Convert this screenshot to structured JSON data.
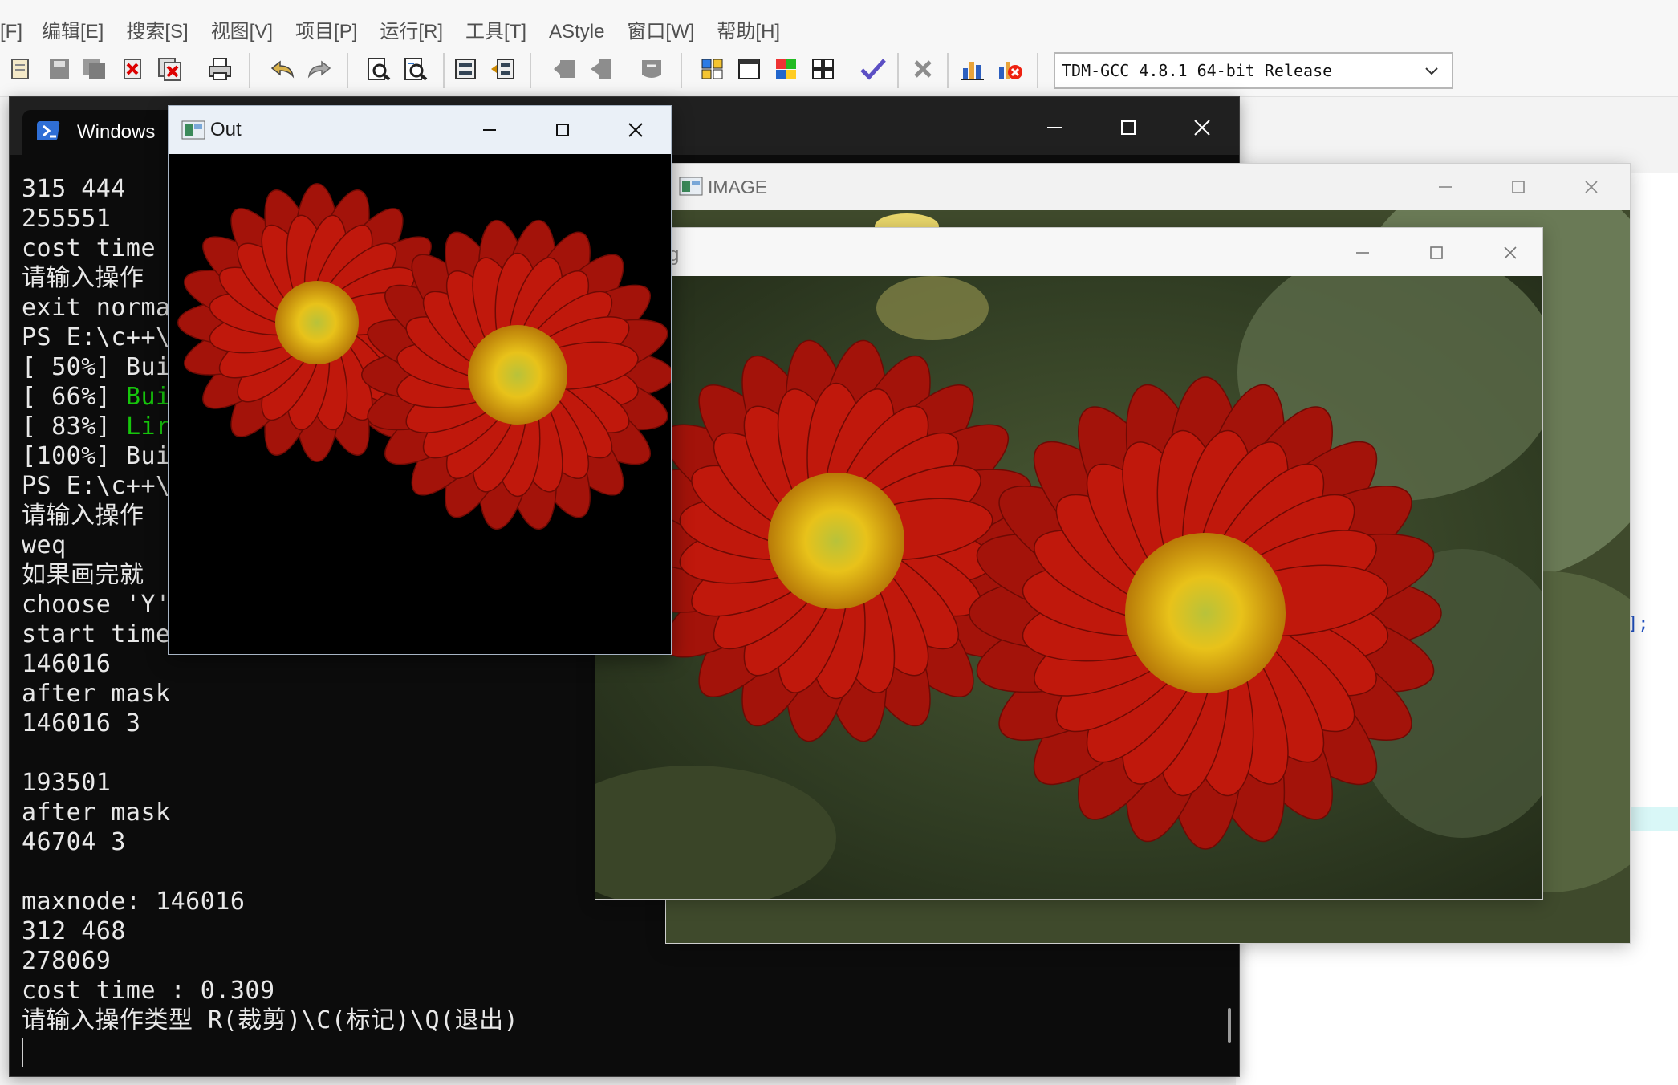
{
  "ide": {
    "menu": [
      "[F]",
      "编辑[E]",
      "搜索[S]",
      "视图[V]",
      "项目[P]",
      "运行[R]",
      "工具[T]",
      "AStyle",
      "窗口[W]",
      "帮助[H]"
    ],
    "compiler": "TDM-GCC 4.8.1 64-bit Release",
    "editor_fragment": "];"
  },
  "terminal": {
    "tab_label": "Windows",
    "lines": [
      "315 444",
      "255551",
      "cost time",
      "请输入操作",
      "exit norma",
      "PS E:\\c++\\",
      "[ 50%] Bui",
      "[ 66%] ",
      "[ 83%] ",
      "[100%] Bui",
      "PS E:\\c++\\",
      "请输入操作",
      "weq",
      "如果画完就",
      "choose 'Y'",
      "start time",
      "146016",
      "after mask",
      "146016 3",
      "",
      "193501",
      "after mask",
      "46704 3",
      "",
      "maxnode: 146016",
      "312 468",
      "278069",
      "cost time : 0.309",
      "请输入操作类型 R(裁剪)\\C(标记)\\Q(退出)"
    ],
    "green_66": "Bui",
    "green_83": "Lir"
  },
  "out_window": {
    "title": "Out"
  },
  "image_window": {
    "title": "IMAGE",
    "inner_fragment": "g"
  },
  "icons": {
    "terminal": "powershell-icon",
    "window_app": "opencv-window-icon",
    "minimize": "minimize-icon",
    "maximize": "maximize-icon",
    "close": "close-icon"
  },
  "colors": {
    "petal": "#c0180c",
    "center": "#e6b400",
    "terminal_bg": "#0c0c0c",
    "terminal_green": "#16c60c"
  }
}
